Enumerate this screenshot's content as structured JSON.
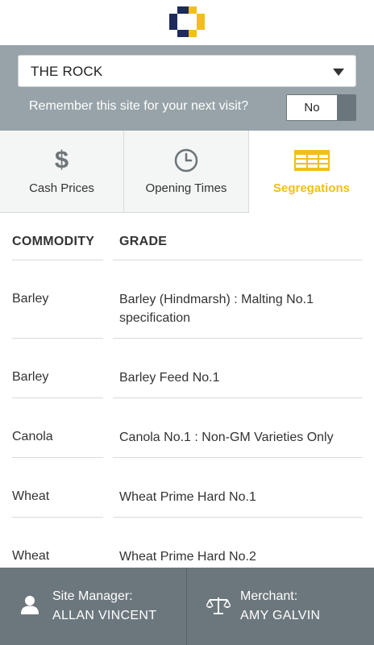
{
  "header": {
    "logo_icon": "logo-icon"
  },
  "site": {
    "selected": "THE ROCK",
    "remember_label": "Remember this site for your next visit?",
    "remember_value": "No"
  },
  "tabs": [
    {
      "label": "Cash Prices",
      "icon": "dollar-icon",
      "active": false
    },
    {
      "label": "Opening Times",
      "icon": "clock-icon",
      "active": false
    },
    {
      "label": "Segregations",
      "icon": "table-icon",
      "active": true
    }
  ],
  "table": {
    "headers": {
      "commodity": "COMMODITY",
      "grade": "GRADE"
    },
    "rows": [
      {
        "commodity": "Barley",
        "grade": "Barley (Hindmarsh) : Malting No.1 specification"
      },
      {
        "commodity": "Barley",
        "grade": "Barley Feed No.1"
      },
      {
        "commodity": "Canola",
        "grade": "Canola No.1 : Non-GM Varieties Only"
      },
      {
        "commodity": "Wheat",
        "grade": "Wheat Prime Hard No.1"
      },
      {
        "commodity": "Wheat",
        "grade": "Wheat Prime Hard No.2"
      }
    ]
  },
  "footer": {
    "manager_role": "Site Manager:",
    "manager_name": "ALLAN VINCENT",
    "merchant_role": "Merchant:",
    "merchant_name": "AMY GALVIN"
  },
  "colors": {
    "accent": "#f2be1a",
    "brand_navy": "#1c2a5c",
    "panel_grey": "#98a3a9",
    "footer_grey": "#6c777d"
  }
}
